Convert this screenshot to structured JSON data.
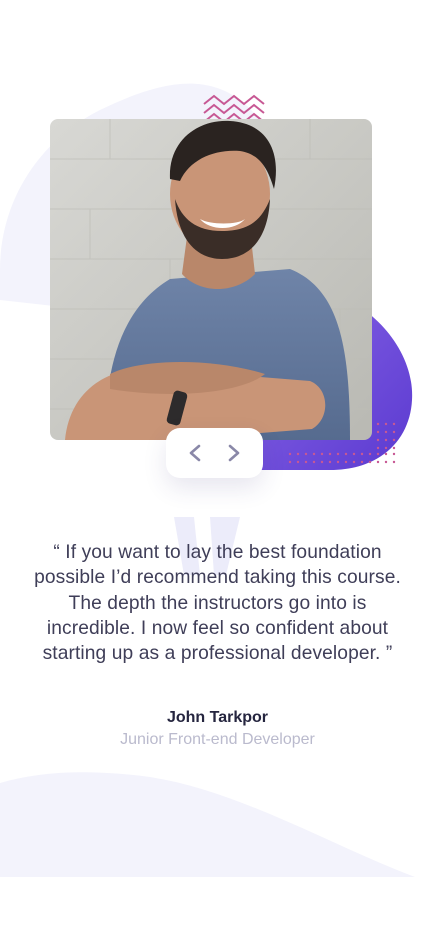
{
  "testimonial": {
    "quote": "“ If you want to lay the best foundation possible I’d recommend taking this course. The depth the instructors go into is incredible. I now feel so confident about starting up as a professional developer. ”",
    "author_name": "John Tarkpor",
    "author_role": "Junior Front-end Developer",
    "photo_icon": "person-photo"
  },
  "navigation": {
    "prev_icon": "chevron-left-icon",
    "next_icon": "chevron-right-icon"
  },
  "colors": {
    "accent_purple": "#6b4ad6",
    "zigzag_pink": "#c75894",
    "background_blob": "#f3f3fc",
    "text_dark": "#25253f",
    "text_muted": "#babacd"
  }
}
